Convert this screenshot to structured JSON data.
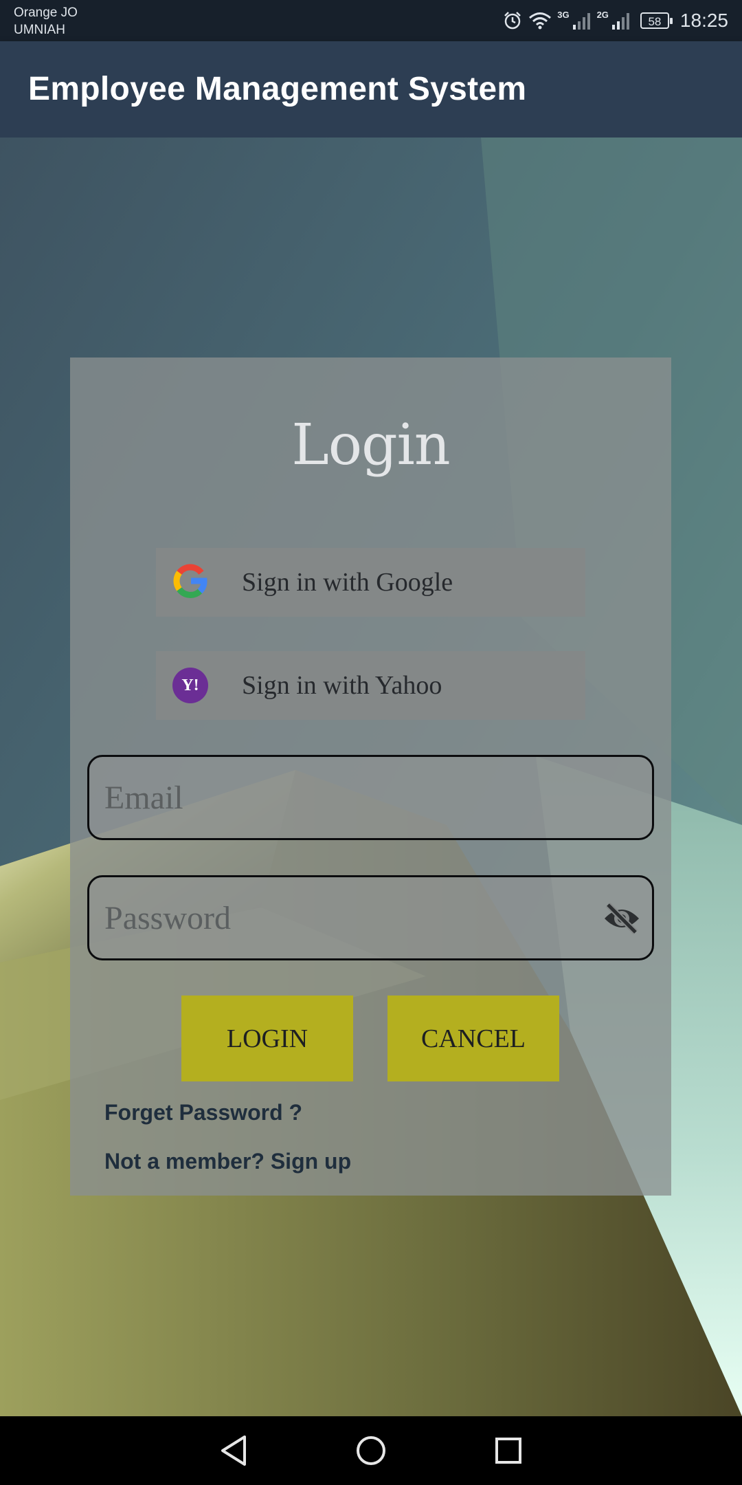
{
  "status_bar": {
    "carrier_1": "Orange JO",
    "carrier_2": "UMNIAH",
    "network_1": "3G",
    "network_2": "2G",
    "battery": "58",
    "time": "18:25",
    "icons": [
      "alarm-icon",
      "wifi-icon",
      "signal-icon",
      "signal-icon",
      "battery-icon"
    ]
  },
  "app_bar": {
    "title": "Employee Management System"
  },
  "login": {
    "title": "Login",
    "google_label": "Sign in with Google",
    "yahoo_label": "Sign in with Yahoo",
    "yahoo_badge": "Y!",
    "email_placeholder": "Email",
    "email_value": "",
    "password_placeholder": "Password",
    "password_value": "",
    "login_button": "LOGIN",
    "cancel_button": "CANCEL",
    "forgot_link": "Forget Password ?",
    "signup_link": "Not a member? Sign up"
  },
  "nav_bar": {
    "icons": [
      "back-icon",
      "home-icon",
      "recents-icon"
    ]
  },
  "colors": {
    "app_bar": "#2d3e53",
    "status_bar": "#17202b",
    "button_accent": "#b4af1f",
    "link_text": "#1f2e3d",
    "yahoo_purple": "#6b2e95"
  }
}
